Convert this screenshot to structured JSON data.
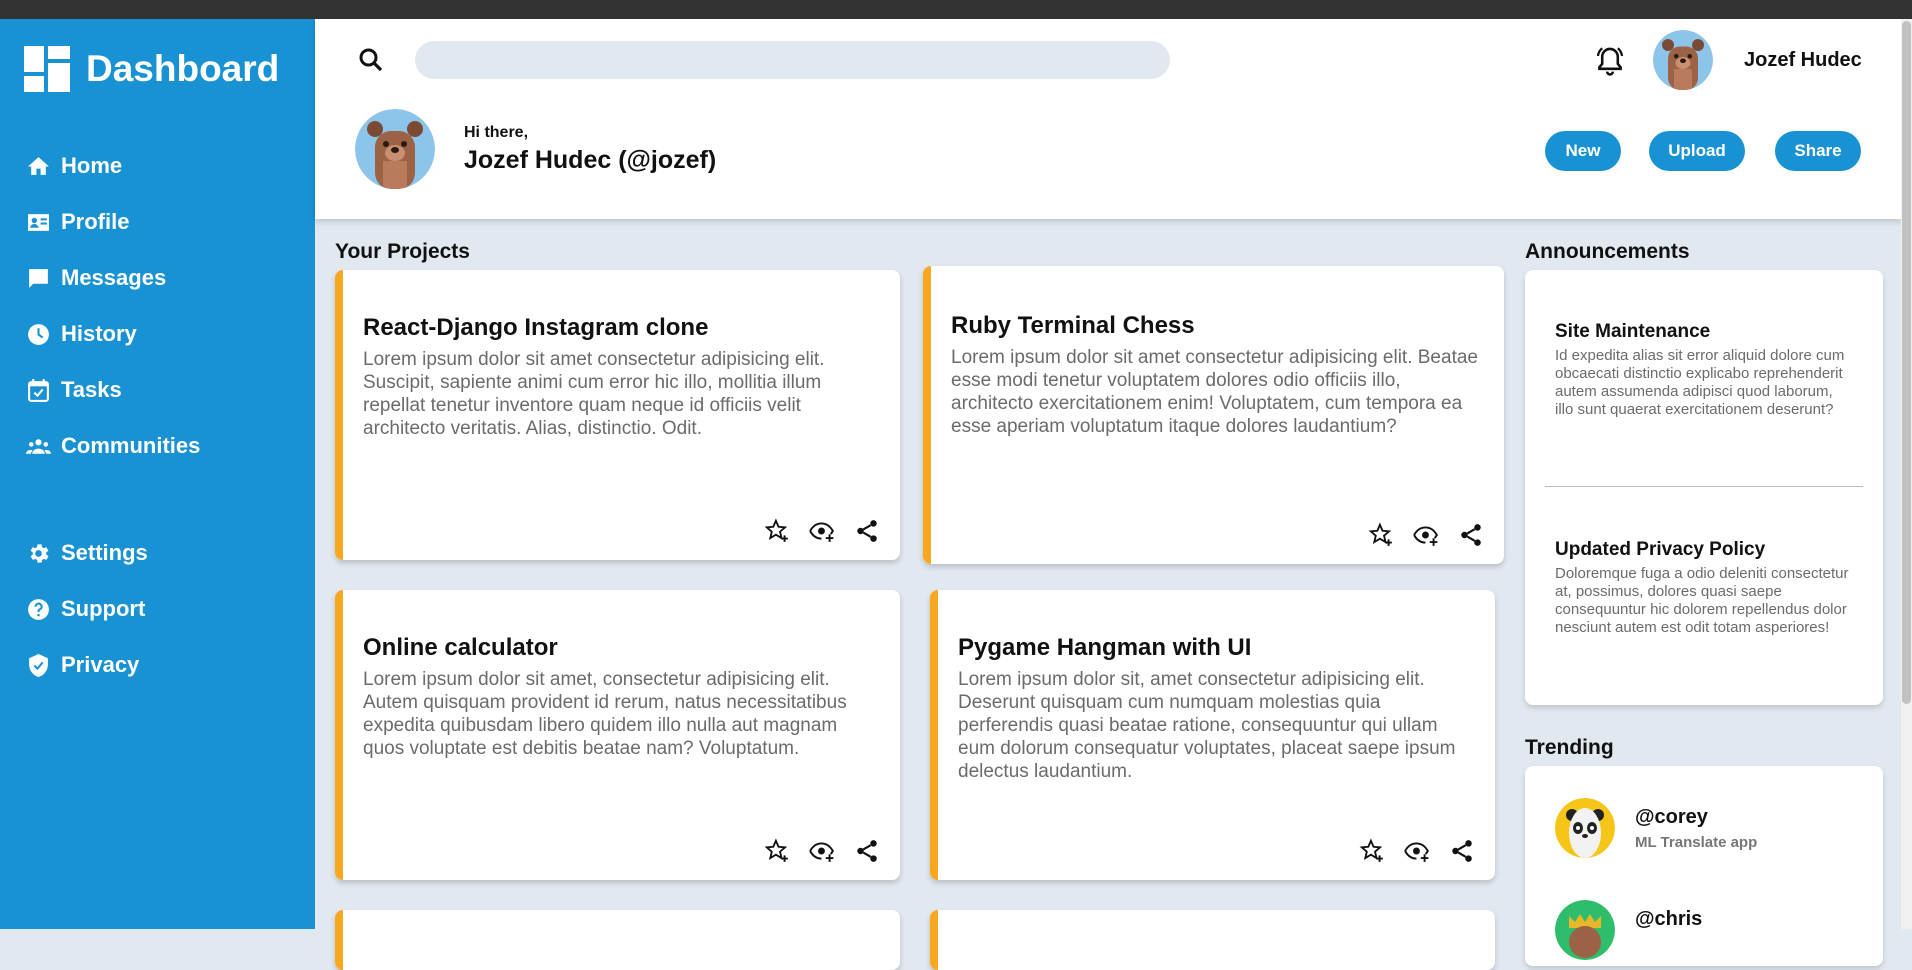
{
  "brand": {
    "title": "Dashboard"
  },
  "sidebar": {
    "items": [
      {
        "label": "Home",
        "icon": "home-icon"
      },
      {
        "label": "Profile",
        "icon": "profile-card-icon"
      },
      {
        "label": "Messages",
        "icon": "message-icon"
      },
      {
        "label": "History",
        "icon": "clock-icon"
      },
      {
        "label": "Tasks",
        "icon": "calendar-check-icon"
      },
      {
        "label": "Communities",
        "icon": "people-icon"
      },
      {
        "label": "Settings",
        "icon": "gear-icon"
      },
      {
        "label": "Support",
        "icon": "help-icon"
      },
      {
        "label": "Privacy",
        "icon": "shield-icon"
      }
    ]
  },
  "header": {
    "search_placeholder": "",
    "user_name": "Jozef Hudec",
    "greeting": "Hi there,",
    "full_name": "Jozef Hudec (@jozef)",
    "buttons": {
      "new": "New",
      "upload": "Upload",
      "share": "Share"
    }
  },
  "projects": {
    "title": "Your Projects",
    "items": [
      {
        "title": "React-Django Instagram clone",
        "desc": "Lorem ipsum dolor sit amet consectetur adipisicing elit. Suscipit, sapiente animi cum error hic illo, mollitia illum repellat tenetur inventore quam neque id officiis velit architecto veritatis. Alias, distinctio. Odit."
      },
      {
        "title": "Ruby Terminal Chess",
        "desc": "Lorem ipsum dolor sit amet consectetur adipisicing elit. Beatae esse modi tenetur voluptatem dolores odio officiis illo, architecto exercitationem enim! Voluptatem, cum tempora ea esse aperiam voluptatum itaque dolores laudantium?"
      },
      {
        "title": "Online calculator",
        "desc": "Lorem ipsum dolor sit amet, consectetur adipisicing elit. Autem quisquam provident id rerum, natus necessitatibus expedita quibusdam libero quidem illo nulla aut magnam quos voluptate est debitis beatae nam? Voluptatum."
      },
      {
        "title": "Pygame Hangman with UI",
        "desc": "Lorem ipsum dolor sit, amet consectetur adipisicing elit. Deserunt quisquam cum numquam molestias quia perferendis quasi beatae ratione, consequuntur qui ullam eum dolorum consequatur voluptates, placeat saepe ipsum delectus laudantium."
      }
    ]
  },
  "announcements": {
    "title": "Announcements",
    "items": [
      {
        "title": "Site Maintenance",
        "body": "Id expedita alias sit error aliquid dolore cum obcaecati distinctio explicabo reprehenderit autem assumenda adipisci quod laborum, illo sunt quaerat exercitationem deserunt?"
      },
      {
        "title": "Updated Privacy Policy",
        "body": "Doloremque fuga a odio deleniti consectetur at, possimus, dolores quasi saepe consequuntur hic dolorem repellendus dolor nesciunt autem est odit totam asperiores!"
      }
    ]
  },
  "trending": {
    "title": "Trending",
    "items": [
      {
        "handle": "@corey",
        "subtitle": "ML Translate app"
      },
      {
        "handle": "@chris",
        "subtitle": ""
      }
    ]
  },
  "colors": {
    "primary": "#1992d4",
    "accent": "#f7a81e",
    "background": "#e2e8f0"
  }
}
